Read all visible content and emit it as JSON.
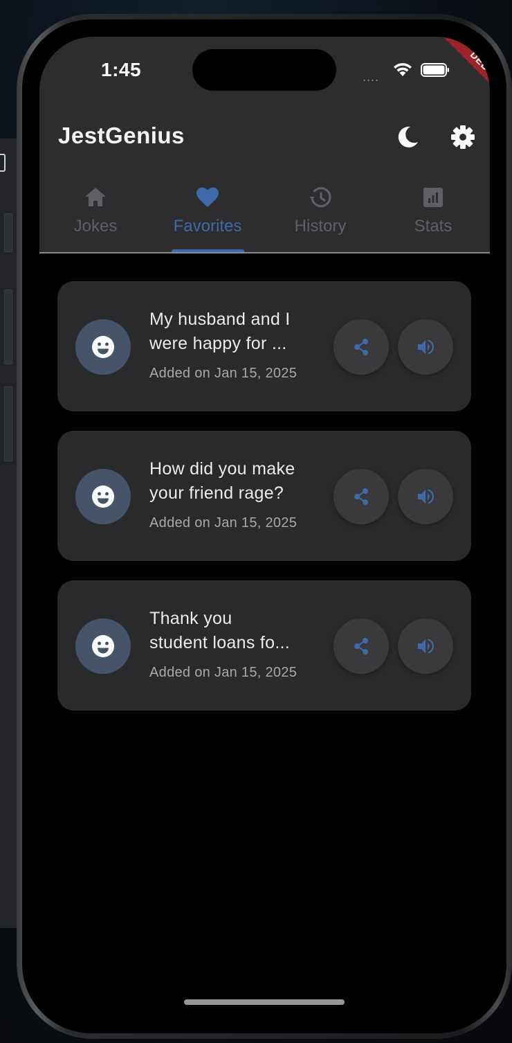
{
  "status_bar": {
    "time": "1:45",
    "signal": "....",
    "debug_banner": "DEBUG"
  },
  "app_bar": {
    "title": "JestGenius",
    "theme_toggle_icon": "moon-icon",
    "settings_icon": "gear-icon"
  },
  "tabs": [
    {
      "label": "Jokes",
      "icon": "home-icon",
      "active": false
    },
    {
      "label": "Favorites",
      "icon": "heart-icon",
      "active": true
    },
    {
      "label": "History",
      "icon": "history-icon",
      "active": false
    },
    {
      "label": "Stats",
      "icon": "bar-chart-icon",
      "active": false
    }
  ],
  "favorites": [
    {
      "text_line1": "My husband and I",
      "text_line2": "were happy for ...",
      "date": "Added on Jan 15, 2025"
    },
    {
      "text_line1": "How did you make",
      "text_line2": "your friend rage?",
      "date": "Added on Jan 15, 2025"
    },
    {
      "text_line1": "Thank you",
      "text_line2": "student loans fo...",
      "date": "Added on Jan 15, 2025"
    }
  ],
  "colors": {
    "accent": "#3d6aa8",
    "app_bar": "#2d2d2f",
    "card": "#2a2a2c",
    "background": "#000000"
  }
}
